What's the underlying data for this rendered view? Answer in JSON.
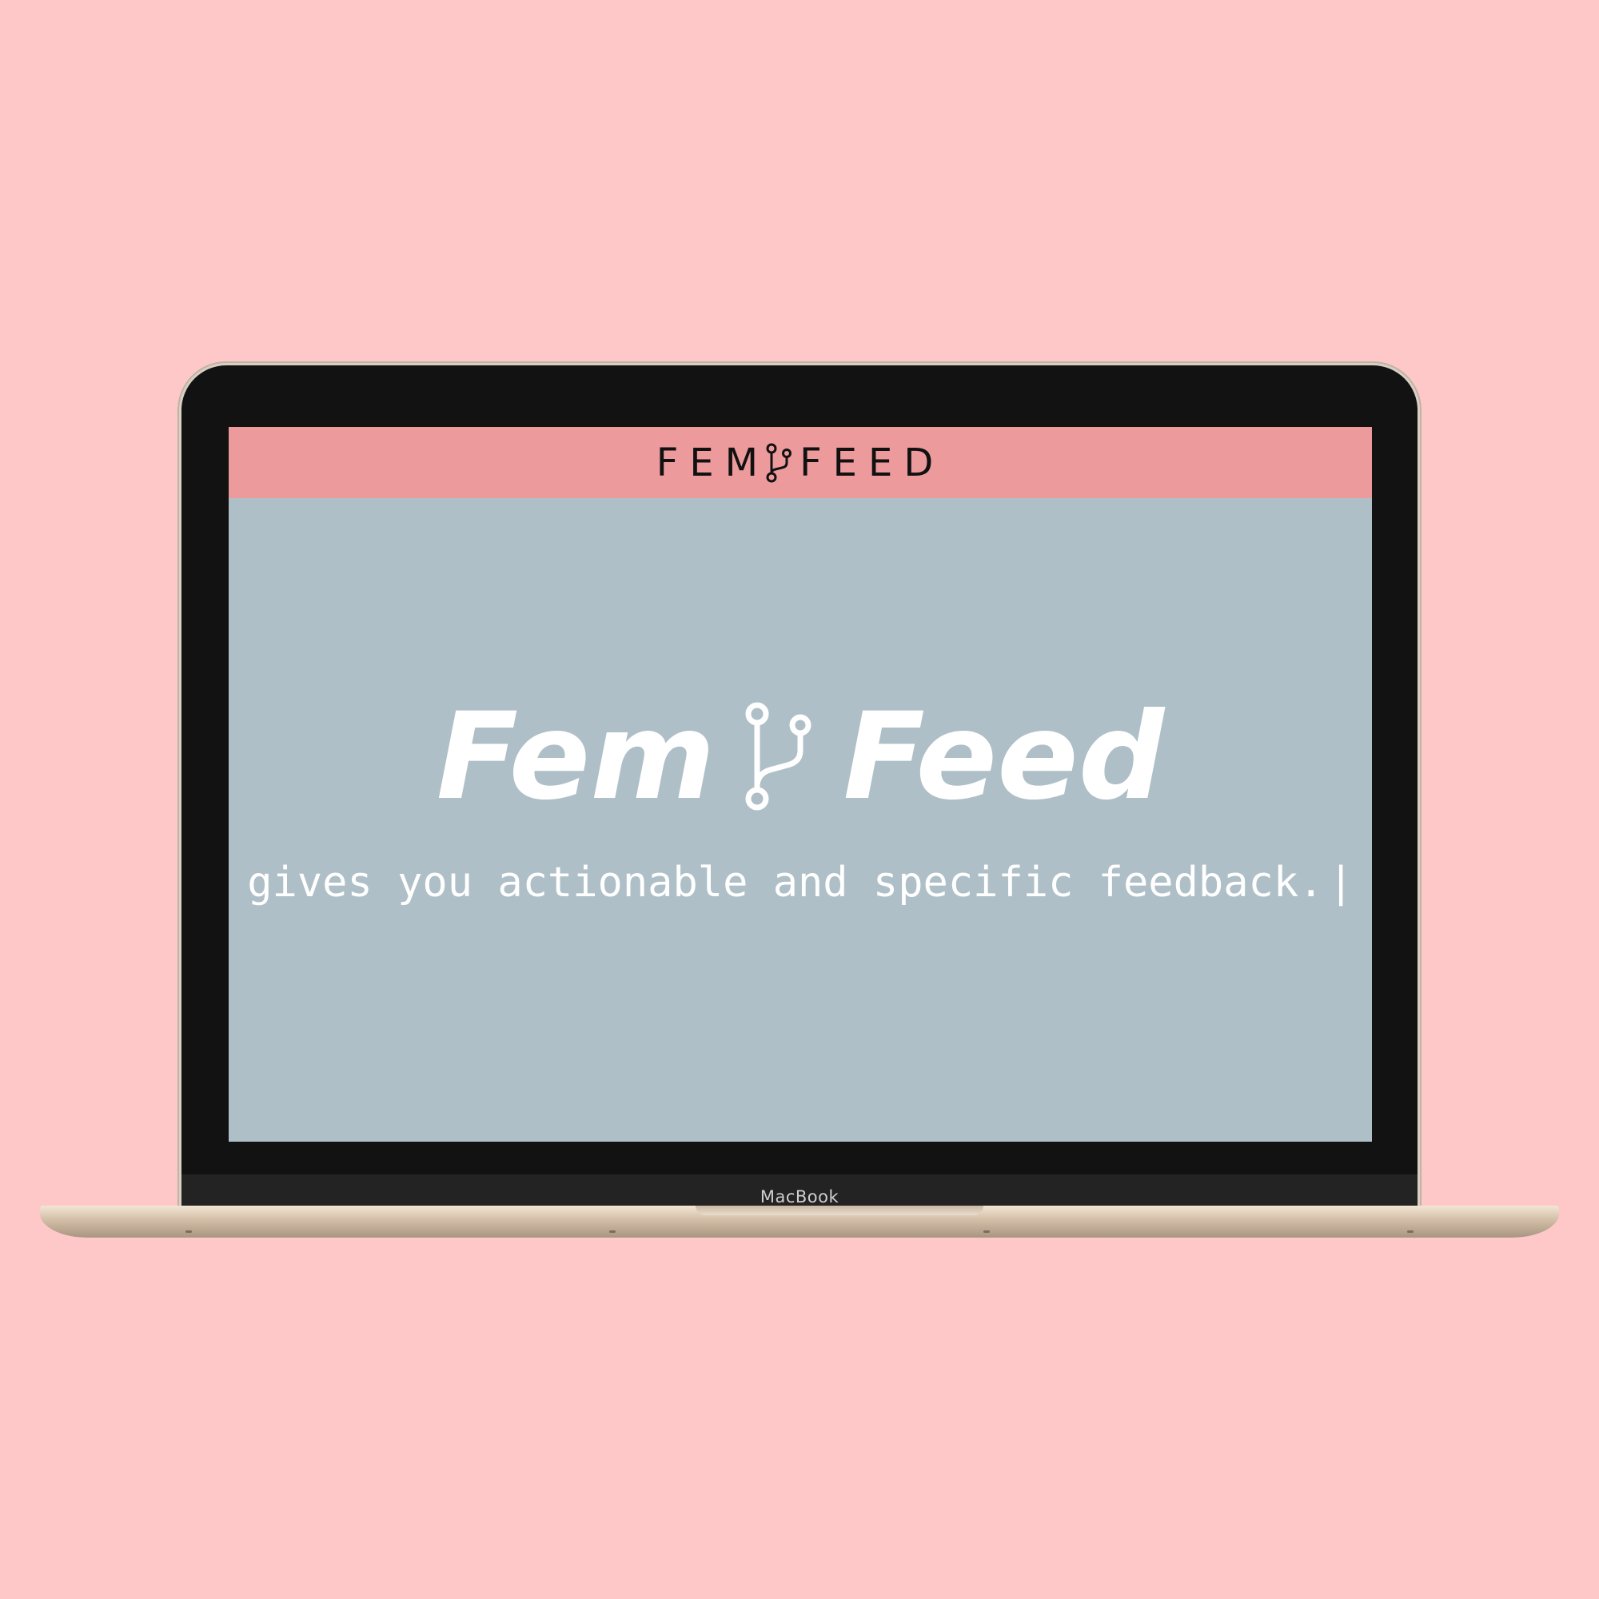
{
  "navbar": {
    "brand_left": "FEM",
    "brand_right": "FEED",
    "brand_icon": "branch-icon"
  },
  "hero": {
    "title_left": "Fem",
    "title_right": "Feed",
    "title_icon": "branch-icon",
    "tagline": "gives you actionable and specific feedback.",
    "cursor": "|"
  },
  "device": {
    "label": "MacBook"
  },
  "colors": {
    "background": "#fec8c8",
    "navbar": "#ec9a9c",
    "screen": "#afbfc7",
    "text": "#ffffff",
    "brand_text": "#111111"
  }
}
